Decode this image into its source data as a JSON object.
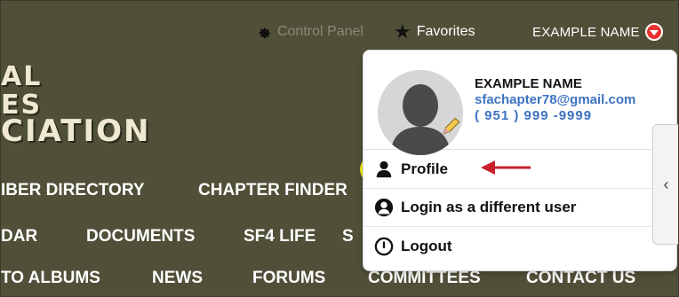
{
  "topbar": {
    "control_panel": "Control Panel",
    "favorites": "Favorites",
    "user_name": "EXAMPLE NAME"
  },
  "logo": {
    "line1": "AL",
    "line2": "ES",
    "line3": "CIATION"
  },
  "nav": {
    "row1": [
      "IBER DIRECTORY",
      "CHAPTER FINDER"
    ],
    "row2": [
      "DAR",
      "DOCUMENTS",
      "SF4 LIFE",
      "S"
    ],
    "row3": [
      "TO ALBUMS",
      "NEWS",
      "FORUMS",
      "COMMITTEES",
      "CONTACT US"
    ]
  },
  "dropdown": {
    "name": "EXAMPLE NAME",
    "email": "sfachapter78@gmail.com",
    "phone": "( 951 ) 999 -9999",
    "items": [
      {
        "label": "Profile",
        "icon": "user-icon"
      },
      {
        "label": "Login as a different user",
        "icon": "user-switch-icon"
      },
      {
        "label": "Logout",
        "icon": "power-icon"
      }
    ]
  },
  "side_tab": {
    "glyph": "‹"
  },
  "colors": {
    "background": "#504f38",
    "accent_red": "#e8322e",
    "link_blue": "#3c72c2",
    "highlight": "#f2ec19"
  }
}
